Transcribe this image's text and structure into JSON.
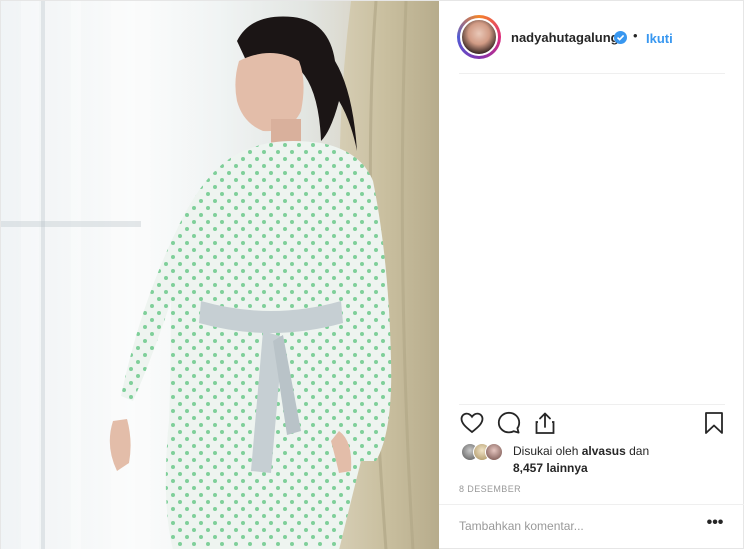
{
  "post": {
    "username": "nadyahutagalung",
    "separator": "•",
    "follow_label": "Ikuti",
    "likes": {
      "prefix": "Disukai oleh",
      "liker": "alvasus",
      "conjunction": "dan",
      "others": "8,457 lainnya"
    },
    "date": "8 DESEMBER",
    "comment_placeholder": "Tambahkan komentar...",
    "more_label": "•••"
  },
  "icons": {
    "verified": "verified-badge-icon",
    "like": "heart-icon",
    "comment": "comment-bubble-icon",
    "share": "share-arrow-icon",
    "save": "bookmark-icon",
    "more": "ellipsis-icon"
  },
  "colors": {
    "accent": "#3897f0",
    "text": "#262626",
    "muted": "#999999",
    "divider": "#efefef"
  }
}
